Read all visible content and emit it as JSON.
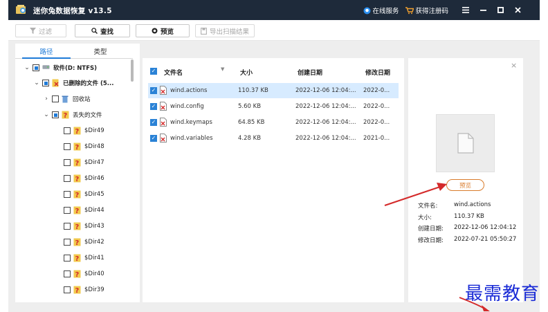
{
  "titlebar": {
    "title": "迷你兔数据恢复 v13.5",
    "online_service": "在线服务",
    "get_code": "获得注册码",
    "menu_icon": "menu-icon",
    "minimize_icon": "minimize-icon",
    "maximize_icon": "maximize-icon",
    "close_icon": "close-icon"
  },
  "toolbar": {
    "filter": "过滤",
    "find": "查找",
    "preview": "预览",
    "export": "导出扫描结果"
  },
  "left_panel": {
    "tabs": [
      "路径",
      "类型"
    ],
    "tree": [
      {
        "label": "软件(D: NTFS)",
        "arrow": "⌄",
        "state": "partial"
      },
      {
        "label": "已删除的文件 (5...",
        "arrow": "⌄",
        "state": "partial"
      },
      {
        "label": "回收站",
        "arrow": "›",
        "state": "none"
      },
      {
        "label": "丢失的文件",
        "arrow": "⌄",
        "state": "partial"
      },
      {
        "label": "$Dir49"
      },
      {
        "label": "$Dir48"
      },
      {
        "label": "$Dir47"
      },
      {
        "label": "$Dir46"
      },
      {
        "label": "$Dir45"
      },
      {
        "label": "$Dir44"
      },
      {
        "label": "$Dir43"
      },
      {
        "label": "$Dir42"
      },
      {
        "label": "$Dir41"
      },
      {
        "label": "$Dir40"
      },
      {
        "label": "$Dir39"
      }
    ]
  },
  "file_table": {
    "headers": [
      "文件名",
      "大小",
      "创建日期",
      "修改日期"
    ],
    "rows": [
      {
        "name": "wind.actions",
        "size": "110.37 KB",
        "created": "2022-12-06 12:04:...",
        "modified": "2022-0...",
        "selected": true
      },
      {
        "name": "wind.config",
        "size": "5.60 KB",
        "created": "2022-12-06 12:04:...",
        "modified": "2022-0..."
      },
      {
        "name": "wind.keymaps",
        "size": "64.85 KB",
        "created": "2022-12-06 12:04:...",
        "modified": "2022-0..."
      },
      {
        "name": "wind.variables",
        "size": "4.28 KB",
        "created": "2022-12-06 12:04:...",
        "modified": "2021-0..."
      }
    ]
  },
  "preview_panel": {
    "close": "×",
    "preview_button": "预览",
    "labels": {
      "name": "文件名:",
      "size": "大小:",
      "created": "创建日期:",
      "modified": "修改日期:"
    },
    "values": {
      "name": "wind.actions",
      "size": "110.37 KB",
      "created": "2022-12-06 12:04:12",
      "modified": "2022-07-21 05:50:27"
    }
  },
  "watermark": "最需教育",
  "colors": {
    "titlebar_bg": "#1e2a3a",
    "accent": "#1e7ad7",
    "selected_row": "#d7ebff",
    "arrow_red": "#d42a2a",
    "preview_orange": "#d97b2b",
    "watermark_blue": "#1a2bd6"
  }
}
